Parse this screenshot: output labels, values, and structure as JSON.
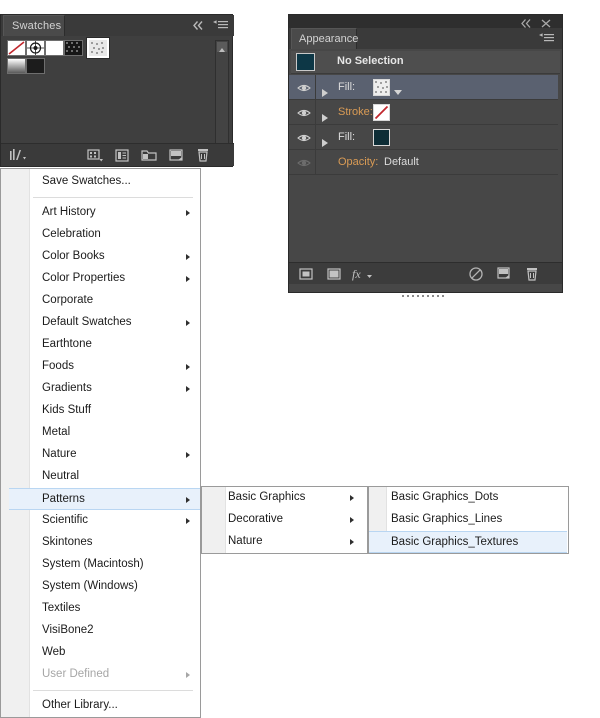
{
  "swatches_panel": {
    "tab_label": "Swatches",
    "collapse_icon": "double-chevron-left-icon",
    "menu_icon": "panel-menu-icon",
    "swatches": [
      {
        "name": "None",
        "type": "none",
        "color": "#ffffff"
      },
      {
        "name": "Registration",
        "type": "registration",
        "color": "#ffffff"
      },
      {
        "name": "White",
        "type": "solid",
        "color": "#ffffff"
      },
      {
        "name": "Black",
        "type": "solid",
        "color": "#111111"
      },
      {
        "name": "Pattern Swatch",
        "type": "pattern",
        "color": "#c9c9c9",
        "selected": true
      },
      {
        "name": "Gradient",
        "type": "gradient",
        "color": "#dadada"
      },
      {
        "name": "Dark",
        "type": "solid",
        "color": "#1c1c1c"
      }
    ],
    "footer_buttons": [
      {
        "name": "swatch-libraries-menu",
        "label": "Swatch Libraries menu"
      },
      {
        "name": "show-swatch-kinds-menu",
        "label": "Show Swatch Kinds menu"
      },
      {
        "name": "swatch-options",
        "label": "Swatch Options"
      },
      {
        "name": "new-color-group",
        "label": "New Color Group"
      },
      {
        "name": "new-swatch",
        "label": "New Swatch"
      },
      {
        "name": "delete-swatch",
        "label": "Delete Swatch"
      }
    ]
  },
  "appearance_panel": {
    "tab_label": "Appearance",
    "collapse_icon": "double-chevron-left-icon",
    "close_icon": "close-icon",
    "menu_icon": "panel-menu-icon",
    "selection_title": "No Selection",
    "rows": [
      {
        "label": "Fill:",
        "label_color": "#dcdcdc",
        "kind": "fill",
        "swatch": "pattern",
        "has_dropdown": true,
        "selected": true,
        "visible": true
      },
      {
        "label": "Stroke:",
        "label_color": "#d99b55",
        "kind": "stroke",
        "swatch": "none",
        "has_dropdown": false,
        "selected": false,
        "visible": true
      },
      {
        "label": "Fill:",
        "label_color": "#dcdcdc",
        "kind": "fill",
        "swatch": "dark",
        "has_dropdown": false,
        "selected": false,
        "visible": true
      },
      {
        "label": "Opacity:",
        "label_color": "#d99b55",
        "kind": "opacity",
        "value": "Default",
        "selected": false,
        "visible": false
      }
    ],
    "footer_buttons": [
      {
        "name": "add-new-stroke",
        "label": "Add New Stroke"
      },
      {
        "name": "add-new-fill",
        "label": "Add New Fill"
      },
      {
        "name": "add-new-effect",
        "label": "Add New Effect"
      },
      {
        "name": "clear-appearance",
        "label": "Clear Appearance"
      },
      {
        "name": "duplicate-selected-item",
        "label": "Duplicate Selected Item"
      },
      {
        "name": "delete-selected-item",
        "label": "Delete Selected Item"
      }
    ]
  },
  "swatch_menu": {
    "items": [
      {
        "label": "Save Swatches...",
        "submenu": false,
        "disabled": false,
        "highlighted": false,
        "separator_after": true
      },
      {
        "label": "Art History",
        "submenu": true,
        "disabled": false,
        "highlighted": false
      },
      {
        "label": "Celebration",
        "submenu": false,
        "disabled": false,
        "highlighted": false
      },
      {
        "label": "Color Books",
        "submenu": true,
        "disabled": false,
        "highlighted": false
      },
      {
        "label": "Color Properties",
        "submenu": true,
        "disabled": false,
        "highlighted": false
      },
      {
        "label": "Corporate",
        "submenu": false,
        "disabled": false,
        "highlighted": false
      },
      {
        "label": "Default Swatches",
        "submenu": true,
        "disabled": false,
        "highlighted": false
      },
      {
        "label": "Earthtone",
        "submenu": false,
        "disabled": false,
        "highlighted": false
      },
      {
        "label": "Foods",
        "submenu": true,
        "disabled": false,
        "highlighted": false
      },
      {
        "label": "Gradients",
        "submenu": true,
        "disabled": false,
        "highlighted": false
      },
      {
        "label": "Kids Stuff",
        "submenu": false,
        "disabled": false,
        "highlighted": false
      },
      {
        "label": "Metal",
        "submenu": false,
        "disabled": false,
        "highlighted": false
      },
      {
        "label": "Nature",
        "submenu": true,
        "disabled": false,
        "highlighted": false
      },
      {
        "label": "Neutral",
        "submenu": false,
        "disabled": false,
        "highlighted": false
      },
      {
        "label": "Patterns",
        "submenu": true,
        "disabled": false,
        "highlighted": true
      },
      {
        "label": "Scientific",
        "submenu": true,
        "disabled": false,
        "highlighted": false
      },
      {
        "label": "Skintones",
        "submenu": false,
        "disabled": false,
        "highlighted": false
      },
      {
        "label": "System (Macintosh)",
        "submenu": false,
        "disabled": false,
        "highlighted": false
      },
      {
        "label": "System (Windows)",
        "submenu": false,
        "disabled": false,
        "highlighted": false
      },
      {
        "label": "Textiles",
        "submenu": false,
        "disabled": false,
        "highlighted": false
      },
      {
        "label": "VisiBone2",
        "submenu": false,
        "disabled": false,
        "highlighted": false
      },
      {
        "label": "Web",
        "submenu": false,
        "disabled": false,
        "highlighted": false
      },
      {
        "label": "User Defined",
        "submenu": true,
        "disabled": true,
        "highlighted": false,
        "separator_after": true
      },
      {
        "label": "Other Library...",
        "submenu": false,
        "disabled": false,
        "highlighted": false
      }
    ]
  },
  "patterns_submenu": {
    "items": [
      {
        "label": "Basic Graphics",
        "submenu": true,
        "highlighted": false
      },
      {
        "label": "Decorative",
        "submenu": true,
        "highlighted": false
      },
      {
        "label": "Nature",
        "submenu": true,
        "highlighted": false
      }
    ]
  },
  "basic_graphics_submenu": {
    "items": [
      {
        "label": "Basic Graphics_Dots",
        "highlighted": false
      },
      {
        "label": "Basic Graphics_Lines",
        "highlighted": false
      },
      {
        "label": "Basic Graphics_Textures",
        "highlighted": true
      }
    ]
  },
  "colors": {
    "panel_bg": "#474747",
    "panel_header": "#3a3a3a",
    "menu_bg": "#ffffff",
    "menu_gutter": "#f0f0f0",
    "highlight": "#e8f1fb",
    "highlight_border": "#b9d6f2",
    "row_selected": "#5a6170",
    "orange_label": "#d99b55"
  }
}
